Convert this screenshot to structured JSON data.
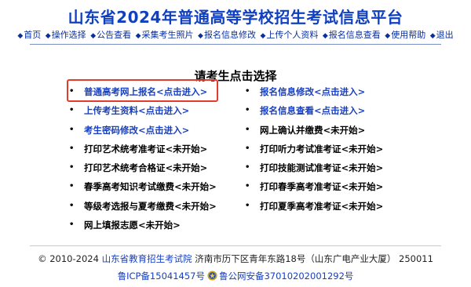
{
  "title": "山东省2024年普通高等学校招生考试信息平台",
  "nav": [
    {
      "label": "首页"
    },
    {
      "label": "操作选择"
    },
    {
      "label": "公告查看"
    },
    {
      "label": "采集考生照片"
    },
    {
      "label": "报名信息修改"
    },
    {
      "label": "上传个人资料"
    },
    {
      "label": "报名信息查看"
    },
    {
      "label": "使用帮助"
    },
    {
      "label": "退出"
    }
  ],
  "heading": "请考生点击选择",
  "left_items": [
    {
      "label": "普通高考网上报名<点击进入>",
      "active": true
    },
    {
      "label": "上传考生资料<点击进入>",
      "active": true
    },
    {
      "label": "考生密码修改<点击进入>",
      "active": true
    },
    {
      "label": "打印艺术统考准考证<未开始>",
      "active": false
    },
    {
      "label": "打印艺术统考合格证<未开始>",
      "active": false
    },
    {
      "label": "春季高考知识考试缴费<未开始>",
      "active": false
    },
    {
      "label": "等级考选报与夏考缴费<未开始>",
      "active": false
    },
    {
      "label": "网上填报志愿<未开始>",
      "active": false
    }
  ],
  "right_items": [
    {
      "label": "报名信息修改<点击进入>",
      "active": true
    },
    {
      "label": "报名信息查看<点击进入>",
      "active": true
    },
    {
      "label": "网上确认并缴费<未开始>",
      "active": false
    },
    {
      "label": "打印听力考试准考证<未开始>",
      "active": false
    },
    {
      "label": "打印技能测试准考证<未开始>",
      "active": false
    },
    {
      "label": "打印春季高考准考证<未开始>",
      "active": false
    },
    {
      "label": "打印夏季高考准考证<未开始>",
      "active": false
    }
  ],
  "footer": {
    "copyright": "© 2010-2024",
    "org": "山东省教育招生考试院",
    "address": "济南市历下区青年东路18号（山东广电产业大厦） 250011",
    "icp": "鲁ICP备15041457号",
    "police": "鲁公网安备37010202001292号"
  },
  "colors": {
    "link": "#1840c0",
    "title": "#1040c0",
    "highlight": "#e43c2c"
  }
}
